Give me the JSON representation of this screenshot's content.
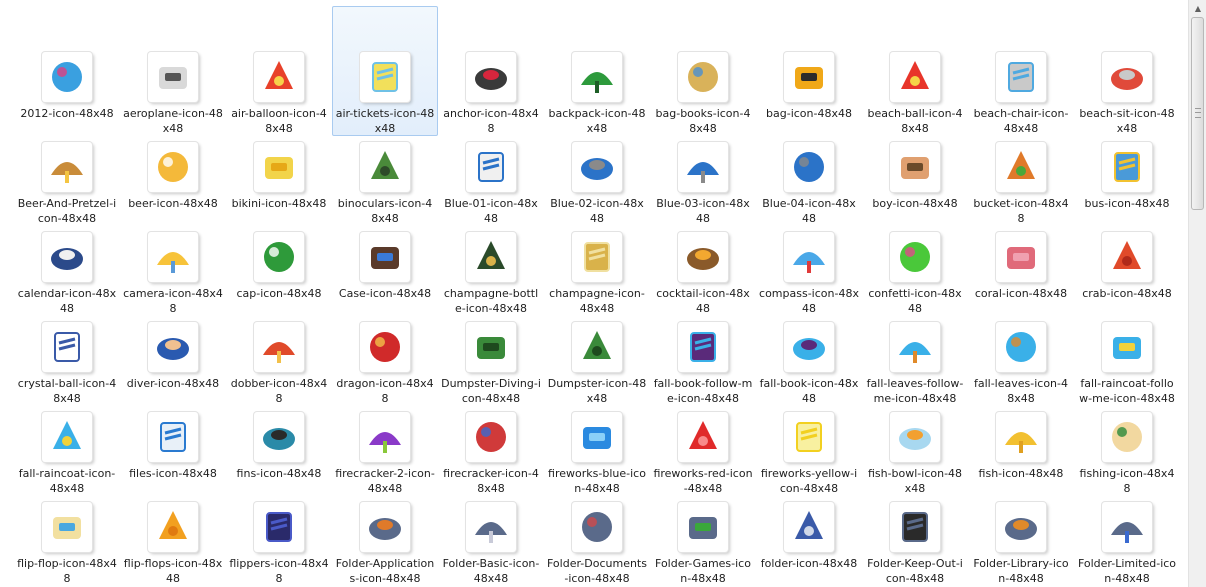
{
  "files": [
    {
      "name": "2012-icon-48x48",
      "icon": "balloons-2012-icon",
      "bg": "#ffffff",
      "c1": "#3aa0e0",
      "c2": "#e04080"
    },
    {
      "name": "aeroplane-icon-48x48",
      "icon": "aeroplane-icon",
      "bg": "#ffffff",
      "c1": "#d9d9d9",
      "c2": "#555555"
    },
    {
      "name": "air-balloon-icon-48x48",
      "icon": "air-balloon-icon",
      "bg": "#ffffff",
      "c1": "#e8412a",
      "c2": "#f7d24a"
    },
    {
      "name": "air-tickets-icon-48x48",
      "icon": "air-tickets-icon",
      "bg": "#ffffff",
      "c1": "#6fc1e6",
      "c2": "#f2e05b"
    },
    {
      "name": "anchor-icon-48x48",
      "icon": "anchor-icon",
      "bg": "#ffffff",
      "c1": "#3a3a3a",
      "c2": "#d7263d"
    },
    {
      "name": "backpack-icon-48x48",
      "icon": "backpack-icon",
      "bg": "#ffffff",
      "c1": "#2d9a3c",
      "c2": "#1d5e26"
    },
    {
      "name": "bag-books-icon-48x48",
      "icon": "bag-books-icon",
      "bg": "#ffffff",
      "c1": "#d9b25a",
      "c2": "#4a8ed1"
    },
    {
      "name": "bag-icon-48x48",
      "icon": "bag-icon",
      "bg": "#ffffff",
      "c1": "#f0a818",
      "c2": "#2b2b2b"
    },
    {
      "name": "beach-ball-icon-48x48",
      "icon": "beach-ball-icon",
      "bg": "#ffffff",
      "c1": "#e8352a",
      "c2": "#f5d547"
    },
    {
      "name": "beach-chair-icon-48x48",
      "icon": "beach-chair-icon",
      "bg": "#ffffff",
      "c1": "#4fa9e0",
      "c2": "#c9c9c9"
    },
    {
      "name": "beach-sit-icon-48x48",
      "icon": "beach-sit-icon",
      "bg": "#ffffff",
      "c1": "#e04a3a",
      "c2": "#c9c9c9"
    },
    {
      "name": "Beer-And-Pretzel-icon-48x48",
      "icon": "beer-pretzel-icon",
      "bg": "#ffffff",
      "c1": "#c98c3a",
      "c2": "#f4c542"
    },
    {
      "name": "beer-icon-48x48",
      "icon": "beer-icon",
      "bg": "#ffffff",
      "c1": "#f4b93a",
      "c2": "#ffffff"
    },
    {
      "name": "bikini-icon-48x48",
      "icon": "bikini-icon",
      "bg": "#ffffff",
      "c1": "#f2d44a",
      "c2": "#e6a817"
    },
    {
      "name": "binoculars-icon-48x48",
      "icon": "binoculars-icon",
      "bg": "#ffffff",
      "c1": "#4a8a3a",
      "c2": "#2d4a28"
    },
    {
      "name": "Blue-01-icon-48x48",
      "icon": "umbrella-icon",
      "bg": "#ffffff",
      "c1": "#2b73c8",
      "c2": "#f0f0f0"
    },
    {
      "name": "Blue-02-icon-48x48",
      "icon": "deck-chair-icon",
      "bg": "#ffffff",
      "c1": "#2b73c8",
      "c2": "#8a8a8a"
    },
    {
      "name": "Blue-03-icon-48x48",
      "icon": "deck-chair-icon",
      "bg": "#ffffff",
      "c1": "#2b73c8",
      "c2": "#8a8a8a"
    },
    {
      "name": "Blue-04-icon-48x48",
      "icon": "umbrella-chair-icon",
      "bg": "#ffffff",
      "c1": "#2b73c8",
      "c2": "#8a8a8a"
    },
    {
      "name": "boy-icon-48x48",
      "icon": "boy-icon",
      "bg": "#ffffff",
      "c1": "#e0a070",
      "c2": "#6a4a2a"
    },
    {
      "name": "bucket-icon-48x48",
      "icon": "bucket-icon",
      "bg": "#ffffff",
      "c1": "#e07a2a",
      "c2": "#4aa83a"
    },
    {
      "name": "bus-icon-48x48",
      "icon": "bus-icon",
      "bg": "#ffffff",
      "c1": "#f2c230",
      "c2": "#4a9ad8"
    },
    {
      "name": "calendar-icon-48x48",
      "icon": "calendar-icon",
      "bg": "#ffffff",
      "c1": "#2b4a8a",
      "c2": "#f0f0f0"
    },
    {
      "name": "camera-icon-48x48",
      "icon": "camera-icon",
      "bg": "#ffffff",
      "c1": "#f7c33a",
      "c2": "#5a9ad8"
    },
    {
      "name": "cap-icon-48x48",
      "icon": "cap-icon",
      "bg": "#ffffff",
      "c1": "#2e9a3a",
      "c2": "#ffffff"
    },
    {
      "name": "Case-icon-48x48",
      "icon": "case-icon",
      "bg": "#ffffff",
      "c1": "#5a3a2a",
      "c2": "#3a7ad8"
    },
    {
      "name": "champagne-bottle-icon-48x48",
      "icon": "champagne-bottle-icon",
      "bg": "#ffffff",
      "c1": "#2a4a2a",
      "c2": "#d9b24a"
    },
    {
      "name": "champagne-icon-48x48",
      "icon": "champagne-glasses-icon",
      "bg": "#ffffff",
      "c1": "#f0e0a0",
      "c2": "#d9b24a"
    },
    {
      "name": "cocktail-icon-48x48",
      "icon": "coconut-cocktail-icon",
      "bg": "#ffffff",
      "c1": "#8a5a2a",
      "c2": "#f2a830"
    },
    {
      "name": "compass-icon-48x48",
      "icon": "compass-icon",
      "bg": "#ffffff",
      "c1": "#4aa8e8",
      "c2": "#e03a3a"
    },
    {
      "name": "confetti-icon-48x48",
      "icon": "confetti-icon",
      "bg": "#ffffff",
      "c1": "#4ac83a",
      "c2": "#e04a8a"
    },
    {
      "name": "coral-icon-48x48",
      "icon": "coral-icon",
      "bg": "#ffffff",
      "c1": "#e06a7a",
      "c2": "#f0a0b0"
    },
    {
      "name": "crab-icon-48x48",
      "icon": "crab-icon",
      "bg": "#ffffff",
      "c1": "#e04a2a",
      "c2": "#b02a1a"
    },
    {
      "name": "crystal-ball-icon-48x48",
      "icon": "crystal-ball-icon",
      "bg": "#ffffff",
      "c1": "#3a5aa8",
      "c2": "#ffffff"
    },
    {
      "name": "diver-icon-48x48",
      "icon": "diver-icon",
      "bg": "#ffffff",
      "c1": "#2a5ab0",
      "c2": "#f0c090"
    },
    {
      "name": "dobber-icon-48x48",
      "icon": "dobber-icon",
      "bg": "#ffffff",
      "c1": "#e04a2a",
      "c2": "#f2c04a"
    },
    {
      "name": "dragon-icon-48x48",
      "icon": "dragon-2012-icon",
      "bg": "#ffffff",
      "c1": "#d02a2a",
      "c2": "#f2c04a"
    },
    {
      "name": "Dumpster-Diving-icon-48x48",
      "icon": "dumpster-icon",
      "bg": "#ffffff",
      "c1": "#3a8a3a",
      "c2": "#1e4a1e"
    },
    {
      "name": "Dumpster-icon-48x48",
      "icon": "dumpster-icon",
      "bg": "#ffffff",
      "c1": "#3a8a3a",
      "c2": "#1e4a1e"
    },
    {
      "name": "fall-book-follow-me-icon-48x48",
      "icon": "bird-book-icon",
      "bg": "#ffffff",
      "c1": "#3ab0e8",
      "c2": "#5a2a7a"
    },
    {
      "name": "fall-book-icon-48x48",
      "icon": "bird-book-icon",
      "bg": "#ffffff",
      "c1": "#3ab0e8",
      "c2": "#5a2a7a"
    },
    {
      "name": "fall-leaves-follow-me-icon-48x48",
      "icon": "bird-leaves-icon",
      "bg": "#ffffff",
      "c1": "#3ab0e8",
      "c2": "#e08a2a"
    },
    {
      "name": "fall-leaves-icon-48x48",
      "icon": "bird-leaves-icon",
      "bg": "#ffffff",
      "c1": "#3ab0e8",
      "c2": "#e08a2a"
    },
    {
      "name": "fall-raincoat-follow-me-icon-48x48",
      "icon": "bird-raincoat-icon",
      "bg": "#ffffff",
      "c1": "#3ab0e8",
      "c2": "#f2d23a"
    },
    {
      "name": "fall-raincoat-icon-48x48",
      "icon": "bird-raincoat-icon",
      "bg": "#ffffff",
      "c1": "#3ab0e8",
      "c2": "#f2d23a"
    },
    {
      "name": "files-icon-48x48",
      "icon": "files-wave-icon",
      "bg": "#ffffff",
      "c1": "#2a7ad0",
      "c2": "#e8f0f8"
    },
    {
      "name": "fins-icon-48x48",
      "icon": "fins-icon",
      "bg": "#ffffff",
      "c1": "#2a8aa8",
      "c2": "#2a2a2a"
    },
    {
      "name": "firecracker-2-icon-48x48",
      "icon": "firecracker-2-icon",
      "bg": "#ffffff",
      "c1": "#8a3ac8",
      "c2": "#8ac83a"
    },
    {
      "name": "firecracker-icon-48x48",
      "icon": "firecracker-icon",
      "bg": "#ffffff",
      "c1": "#d03a3a",
      "c2": "#3a6ad0"
    },
    {
      "name": "fireworks-blue-icon-48x48",
      "icon": "fireworks-icon",
      "bg": "#ffffff",
      "c1": "#2a8ae0",
      "c2": "#8ad0f8"
    },
    {
      "name": "fireworks-red-icon-48x48",
      "icon": "fireworks-icon",
      "bg": "#ffffff",
      "c1": "#e02a2a",
      "c2": "#f88a8a"
    },
    {
      "name": "fireworks-yellow-icon-48x48",
      "icon": "fireworks-icon",
      "bg": "#ffffff",
      "c1": "#f2d020",
      "c2": "#f8f0a0"
    },
    {
      "name": "fish-bowl-icon-48x48",
      "icon": "fish-bowl-icon",
      "bg": "#ffffff",
      "c1": "#a8d8f0",
      "c2": "#f2a030"
    },
    {
      "name": "fish-icon-48x48",
      "icon": "fish-icon",
      "bg": "#ffffff",
      "c1": "#f2c030",
      "c2": "#e0a020"
    },
    {
      "name": "fishing-icon-48x48",
      "icon": "fishing-icon",
      "bg": "#ffffff",
      "c1": "#f2d8a0",
      "c2": "#2a8a3a"
    },
    {
      "name": "flip-flop-icon-48x48",
      "icon": "flip-flop-icon",
      "bg": "#ffffff",
      "c1": "#f2e0a0",
      "c2": "#4aa8e0"
    },
    {
      "name": "flip-flops-icon-48x48",
      "icon": "flip-flops-icon",
      "bg": "#ffffff",
      "c1": "#f2a020",
      "c2": "#e07a10"
    },
    {
      "name": "flippers-icon-48x48",
      "icon": "flippers-icon",
      "bg": "#ffffff",
      "c1": "#4a5ac8",
      "c2": "#2a2a6a"
    },
    {
      "name": "Folder-Applications-icon-48x48",
      "icon": "folder-applications-icon",
      "bg": "#ffffff",
      "c1": "#5a6a8a",
      "c2": "#e07a2a"
    },
    {
      "name": "Folder-Basic-icon-48x48",
      "icon": "folder-basic-icon",
      "bg": "#ffffff",
      "c1": "#5a6a8a",
      "c2": "#c8cad8"
    },
    {
      "name": "Folder-Documents-icon-48x48",
      "icon": "folder-documents-icon",
      "bg": "#ffffff",
      "c1": "#5a6a8a",
      "c2": "#d04a4a"
    },
    {
      "name": "Folder-Games-icon-48x48",
      "icon": "folder-games-icon",
      "bg": "#ffffff",
      "c1": "#5a6a8a",
      "c2": "#3aa83a"
    },
    {
      "name": "folder-icon-48x48",
      "icon": "folder-icon",
      "bg": "#ffffff",
      "c1": "#3a5aa8",
      "c2": "#d0d8e8"
    },
    {
      "name": "Folder-Keep-Out-icon-48x48",
      "icon": "folder-keep-out-icon",
      "bg": "#ffffff",
      "c1": "#5a6a8a",
      "c2": "#2a2a2a"
    },
    {
      "name": "Folder-Library-icon-48x48",
      "icon": "folder-library-icon",
      "bg": "#ffffff",
      "c1": "#5a6a8a",
      "c2": "#e08a2a"
    },
    {
      "name": "Folder-Limited-icon-48x48",
      "icon": "folder-limited-icon",
      "bg": "#ffffff",
      "c1": "#5a6a8a",
      "c2": "#3a6ad0"
    }
  ],
  "selected_index": 3
}
